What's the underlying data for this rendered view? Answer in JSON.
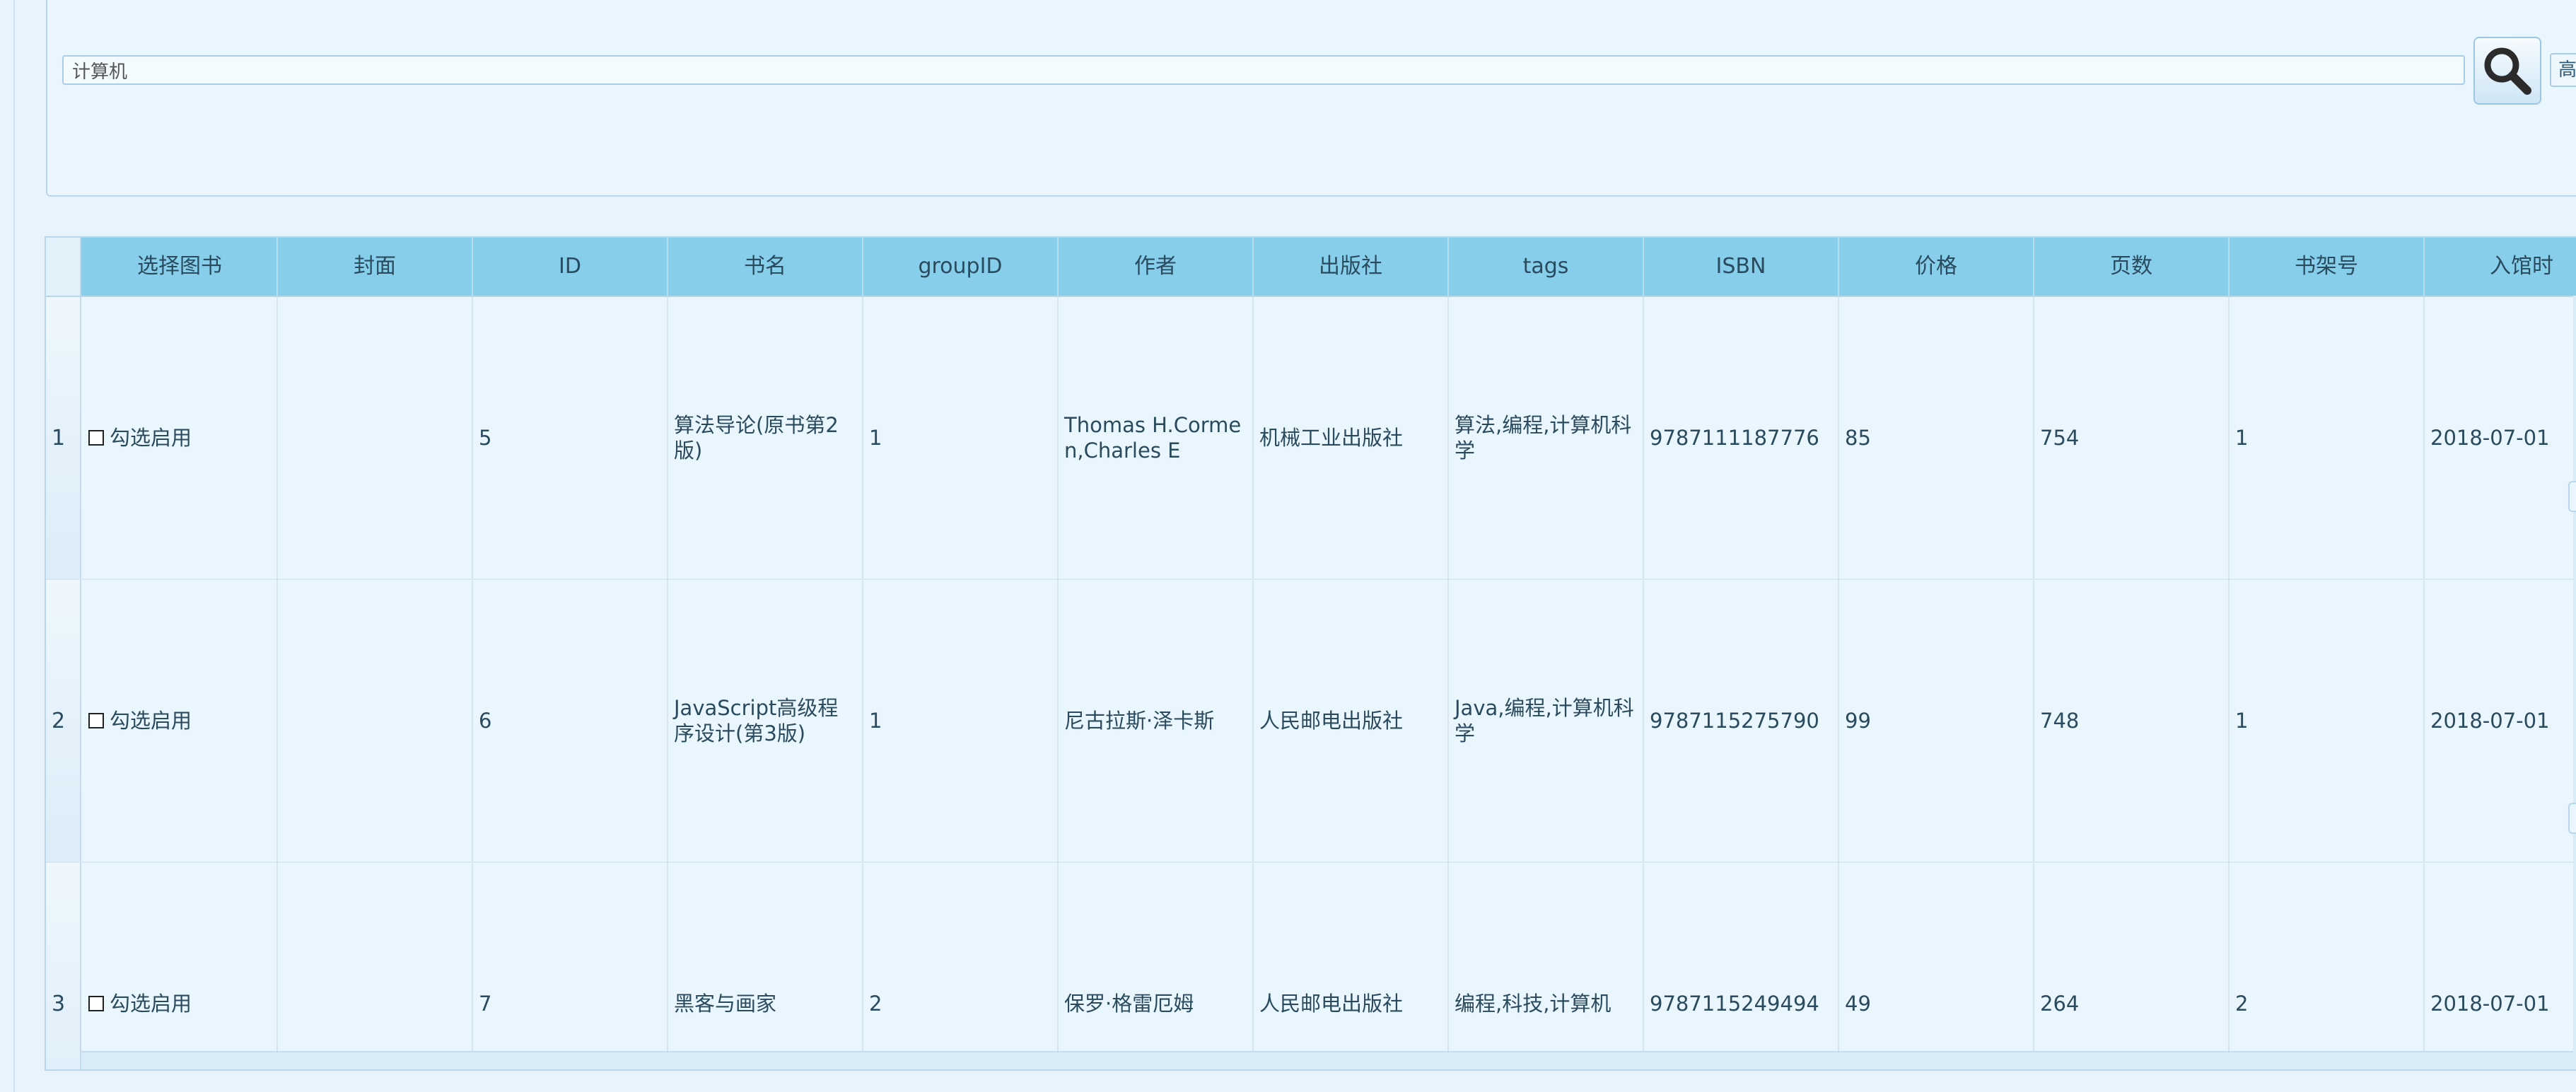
{
  "search": {
    "value": "计算机",
    "advanced_label": "高级"
  },
  "grid": {
    "columns": [
      "选择图书",
      "封面",
      "ID",
      "书名",
      "groupID",
      "作者",
      "出版社",
      "tags",
      "ISBN",
      "价格",
      "页数",
      "书架号",
      "入馆时"
    ],
    "checkbox_label": "勾选启用",
    "rows": [
      {
        "num": "1",
        "cover": "",
        "id": "5",
        "title": "算法导论(原书第2版)",
        "groupID": "1",
        "author": "Thomas H.Cormen,Charles E",
        "publisher": "机械工业出版社",
        "tags": "算法,编程,计算机科学",
        "isbn": "9787111187776",
        "price": "85",
        "pages": "754",
        "shelf": "1",
        "date": "2018-07-01"
      },
      {
        "num": "2",
        "cover": "",
        "id": "6",
        "title": "JavaScript高级程序设计(第3版)",
        "groupID": "1",
        "author": "尼古拉斯·泽卡斯",
        "publisher": "人民邮电出版社",
        "tags": "Java,编程,计算机科学",
        "isbn": "9787115275790",
        "price": "99",
        "pages": "748",
        "shelf": "1",
        "date": "2018-07-01"
      },
      {
        "num": "3",
        "cover": "",
        "id": "7",
        "title": "黑客与画家",
        "groupID": "2",
        "author": "保罗·格雷厄姆",
        "publisher": "人民邮电出版社",
        "tags": "编程,科技,计算机",
        "isbn": "9787115249494",
        "price": "49",
        "pages": "264",
        "shelf": "2",
        "date": "2018-07-01"
      }
    ]
  }
}
